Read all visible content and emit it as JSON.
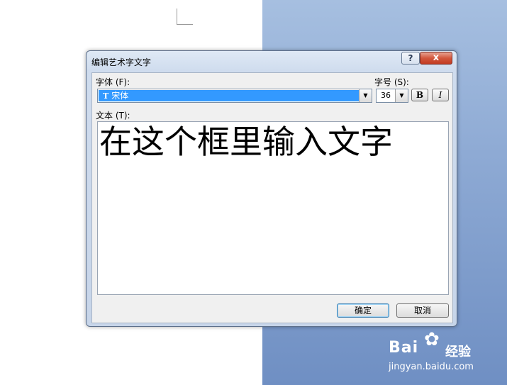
{
  "dialog": {
    "title": "编辑艺术字文字",
    "help_glyph": "?",
    "close_glyph": "x"
  },
  "font": {
    "label": "字体 (F):",
    "value": "宋体",
    "type_glyph": "T"
  },
  "size": {
    "label": "字号 (S):",
    "value": "36"
  },
  "format": {
    "bold": "B",
    "italic": "I"
  },
  "text": {
    "label": "文本 (T):",
    "value": "在这个框里输入文字"
  },
  "buttons": {
    "ok": "确定",
    "cancel": "取消"
  },
  "watermark": {
    "brand": "Bai",
    "brand_cn": "经验",
    "url": "jingyan.baidu.com"
  },
  "icons": [
    "help-icon",
    "close-icon",
    "dropdown-arrow-icon",
    "truetype-icon",
    "paw-icon"
  ]
}
